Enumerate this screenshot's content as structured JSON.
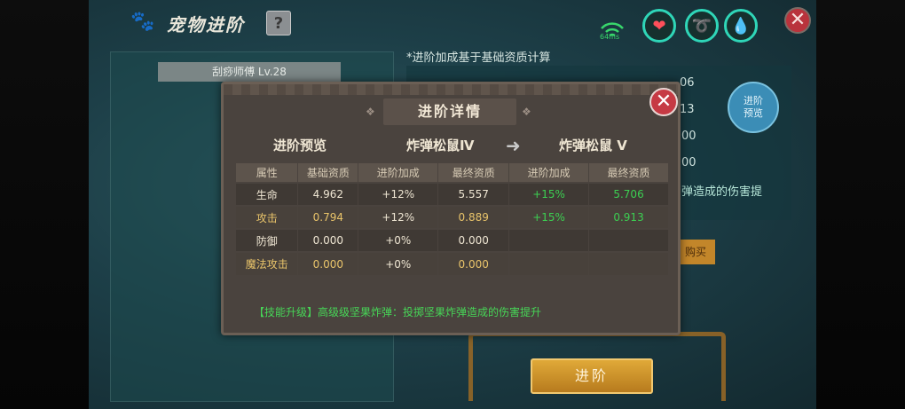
{
  "header": {
    "title": "宠物进阶",
    "help_label": "?",
    "network_speed": "64ms",
    "close_label": "✕"
  },
  "colors": {
    "accent_green": "#3ccf52",
    "gold_text": "#e9c46a",
    "ring_teal": "#2fd6b8",
    "close_red": "#c63a44"
  },
  "background": {
    "note": "*进阶加成基于基础资质计算",
    "pet_name": "刮痧师傅 Lv.28",
    "numbers": [
      "06",
      "13",
      "00",
      "00"
    ],
    "preview_button": "进阶\n预览",
    "skill_text_partial": "弹造成的伤害提",
    "buy_label": "购买",
    "advance_button": "进阶"
  },
  "modal": {
    "title": "进阶详情",
    "close_label": "✕",
    "preview_label": "进阶预览",
    "from_name": "炸弹松鼠Ⅳ",
    "to_name": "炸弹松鼠 Ⅴ",
    "columns": [
      "属性",
      "基础资质",
      "进阶加成",
      "最终资质",
      "进阶加成",
      "最终资质"
    ],
    "rows": [
      {
        "attr": "生命",
        "base": "4.962",
        "bonus": "+12%",
        "final": "5.557",
        "next_bonus": "+15%",
        "next_final": "5.706"
      },
      {
        "attr": "攻击",
        "base": "0.794",
        "bonus": "+12%",
        "final": "0.889",
        "next_bonus": "+15%",
        "next_final": "0.913"
      },
      {
        "attr": "防御",
        "base": "0.000",
        "bonus": "+0%",
        "final": "0.000",
        "next_bonus": "",
        "next_final": ""
      },
      {
        "attr": "魔法攻击",
        "base": "0.000",
        "bonus": "+0%",
        "final": "0.000",
        "next_bonus": "",
        "next_final": ""
      }
    ],
    "skill_upgrade": "【技能升级】高级级坚果炸弹：投掷坚果炸弹造成的伤害提升"
  }
}
